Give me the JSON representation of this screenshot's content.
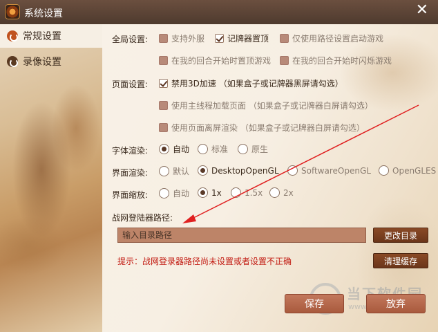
{
  "window": {
    "title": "系统设置",
    "close_glyph": "✕"
  },
  "sidebar": {
    "items": [
      {
        "label": "常规设置",
        "active": true,
        "icon": "swirl-icon"
      },
      {
        "label": "录像设置",
        "active": false,
        "icon": "swirl-icon"
      }
    ]
  },
  "global": {
    "label": "全局设置:",
    "options": [
      {
        "label": "支持外服",
        "checked": false
      },
      {
        "label": "记牌器置顶",
        "checked": true
      },
      {
        "label": "仅使用路径设置启动游戏",
        "checked": false
      },
      {
        "label": "在我的回合开始时置顶游戏",
        "checked": false
      },
      {
        "label": "在我的回合开始时闪烁游戏",
        "checked": false
      }
    ]
  },
  "page": {
    "label": "页面设置:",
    "options": [
      {
        "label": "禁用3D加速 （如果盒子或记牌器黑屏请勾选）",
        "checked": true
      },
      {
        "label": "使用主线程加载页面 （如果盒子或记牌器白屏请勾选）",
        "checked": false
      },
      {
        "label": "使用页面离屏渲染 （如果盒子或记牌器白屏请勾选）",
        "checked": false
      }
    ]
  },
  "font_render": {
    "label": "字体渲染:",
    "options": [
      {
        "label": "自动",
        "selected": true
      },
      {
        "label": "标准",
        "selected": false
      },
      {
        "label": "原生",
        "selected": false
      }
    ]
  },
  "ui_render": {
    "label": "界面渲染:",
    "options": [
      {
        "label": "默认",
        "selected": false
      },
      {
        "label": "DesktopOpenGL",
        "selected": true
      },
      {
        "label": "SoftwareOpenGL",
        "selected": false
      },
      {
        "label": "OpenGLES",
        "selected": false
      }
    ]
  },
  "ui_scale": {
    "label": "界面缩放:",
    "options": [
      {
        "label": "自动",
        "selected": false
      },
      {
        "label": "1x",
        "selected": true
      },
      {
        "label": "1.5x",
        "selected": false
      },
      {
        "label": "2x",
        "selected": false
      }
    ]
  },
  "launcher": {
    "label": "战网登陆器路径:",
    "placeholder": "输入目录路径",
    "value": "",
    "change_button": "更改目录",
    "hint": "提示：战网登录器路径尚未设置或者设置不正确",
    "clear_button": "清理缓存"
  },
  "footer": {
    "save_button": "保存",
    "discard_button": "放弃"
  },
  "watermark": {
    "text": "当下软件园",
    "url": "www.downxia.com"
  },
  "colors": {
    "accent": "#c0521f",
    "hint_red": "#c21b12",
    "arrow_red": "#e02020",
    "titlebar": "#5a4336"
  }
}
